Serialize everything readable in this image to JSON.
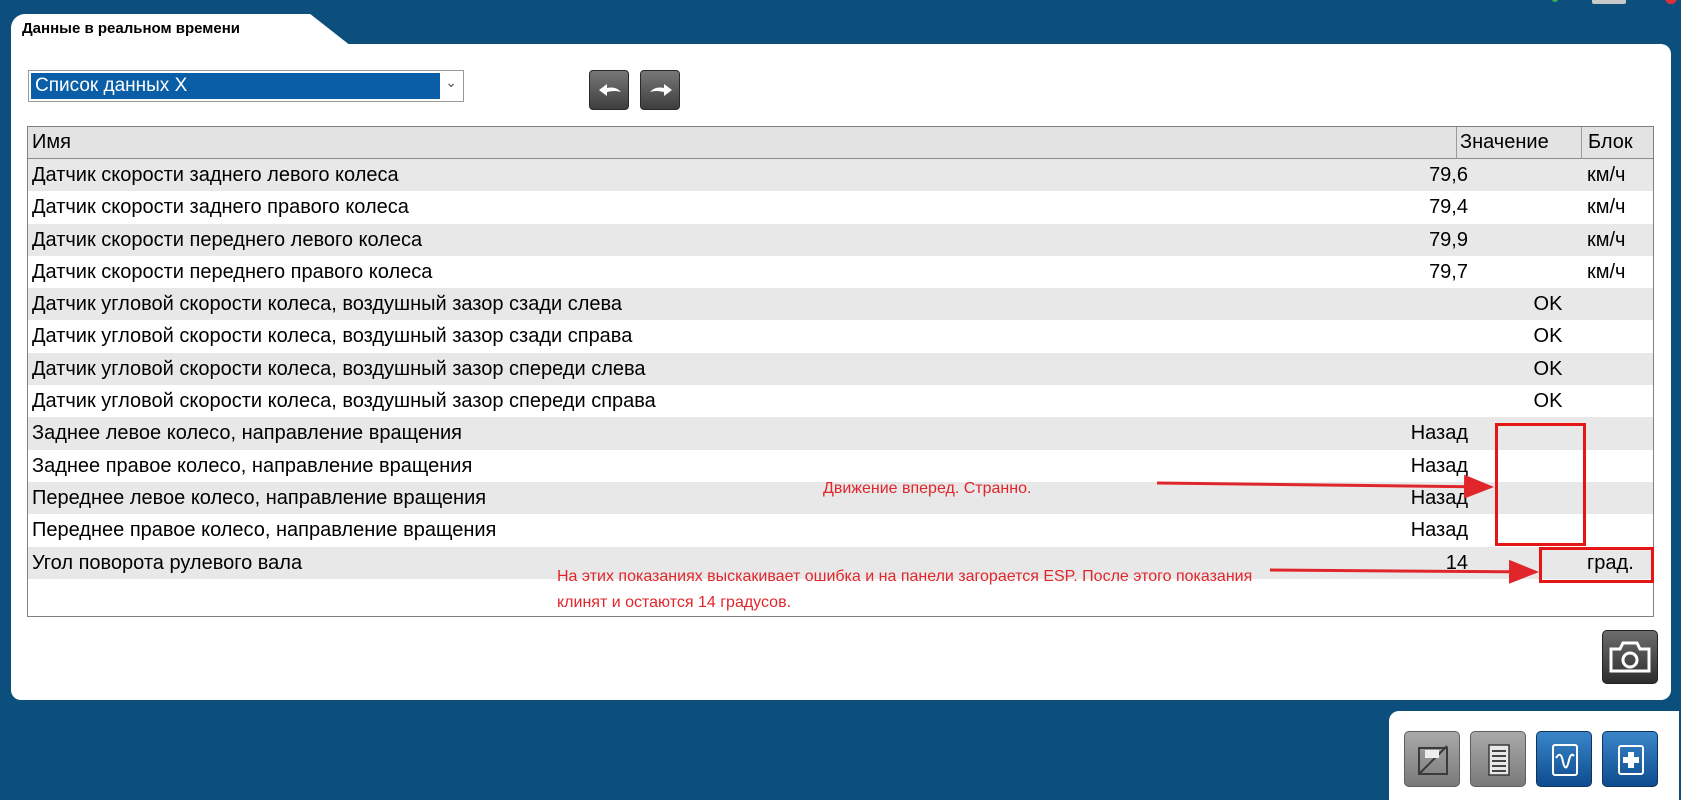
{
  "tab": {
    "title": "Данные в реальном времени"
  },
  "data_list": {
    "selected": "Список данных X"
  },
  "table": {
    "headers": {
      "name": "Имя",
      "value": "Значение",
      "unit": "Блок"
    },
    "rows": [
      {
        "name": "Датчик скорости заднего левого колеса",
        "value": "79,6",
        "unit": "км/ч"
      },
      {
        "name": "Датчик скорости заднего правого колеса",
        "value": "79,4",
        "unit": "км/ч"
      },
      {
        "name": "Датчик скорости переднего левого колеса",
        "value": "79,9",
        "unit": "км/ч"
      },
      {
        "name": "Датчик скорости переднего правого колеса",
        "value": "79,7",
        "unit": "км/ч"
      },
      {
        "name": "Датчик угловой скорости колеса, воздушный зазор сзади слева",
        "value": "OK",
        "unit": ""
      },
      {
        "name": "Датчик угловой скорости колеса, воздушный зазор сзади справа",
        "value": "OK",
        "unit": ""
      },
      {
        "name": "Датчик угловой скорости колеса, воздушный зазор спереди слева",
        "value": "OK",
        "unit": ""
      },
      {
        "name": "Датчик угловой скорости колеса, воздушный зазор спереди справа",
        "value": "OK",
        "unit": ""
      },
      {
        "name": "Заднее левое колесо, направление вращения",
        "value": "Назад",
        "unit": ""
      },
      {
        "name": "Заднее правое колесо, направление вращения",
        "value": "Назад",
        "unit": ""
      },
      {
        "name": "Переднее левое колесо, направление вращения",
        "value": "Назад",
        "unit": ""
      },
      {
        "name": "Переднее правое колесо, направление вращения",
        "value": "Назад",
        "unit": ""
      },
      {
        "name": "Угол поворота рулевого вала",
        "value": "14",
        "unit": "град."
      }
    ]
  },
  "annotations": {
    "direction_note": "Движение вперед. Странно.",
    "angle_note": "На этих показаниях выскакивает ошибка и на панели загорается ESP. После этого показания клинят и остаются 14 градусов."
  },
  "colors": {
    "background": "#0c4e7c",
    "highlight": "#e51616",
    "selection": "#0a5ea8"
  },
  "icons": {
    "nav_back": "arrow-back-icon",
    "nav_forward": "arrow-forward-icon",
    "snapshot": "camera-icon",
    "toolbar": [
      "save-disk-icon",
      "list-icon",
      "graph-icon",
      "medical-module-icon"
    ]
  }
}
